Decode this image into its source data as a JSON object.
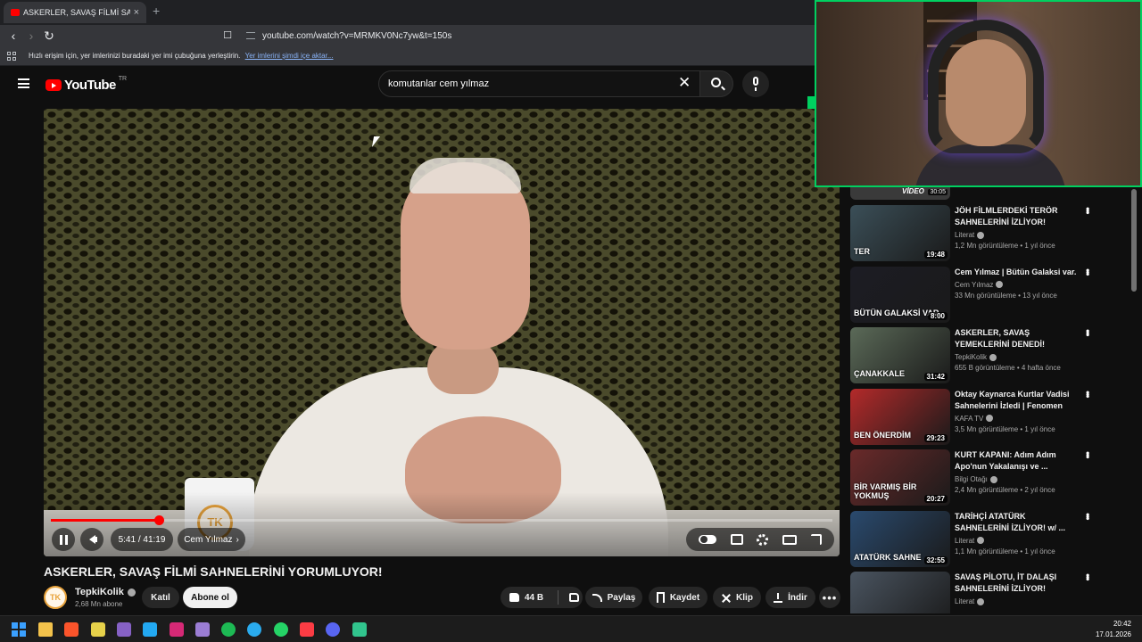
{
  "browser": {
    "tab_title": "ASKERLER, SAVAŞ FİLMİ SAHNE",
    "tab_close": "×",
    "new_tab": "+",
    "url": "youtube.com/watch?v=MRMKV0Nc7yw&t=150s",
    "bookmarks_hint": "Hızlı erişim için, yer imlerinizi buradaki yer imi çubuğuna yerleştirin.",
    "bookmarks_import_link": "Yer imlerini şimdi içe aktar..."
  },
  "youtube": {
    "logo_text": "YouTube",
    "region": "TR",
    "search_query": "komutanlar cem yılmaz"
  },
  "player": {
    "time_display": "5:41 / 41:19",
    "chapter": "Cem Yılmaz",
    "progress_fraction": 0.1376,
    "mug_logo": "TK"
  },
  "video": {
    "title": "ASKERLER, SAVAŞ FİLMİ SAHNELERİNİ YORUMLUYOR!",
    "channel_name": "TepkiKolik",
    "channel_avatar_text": "TK",
    "subscribers": "2,68 Mn abone",
    "join_label": "Katıl",
    "subscribe_label": "Abone ol",
    "likes": "44 B",
    "share_label": "Paylaş",
    "save_label": "Kaydet",
    "clip_label": "Klip",
    "download_label": "İndir"
  },
  "sidebar": {
    "partial": {
      "label": "VİDEO",
      "duration": "30:05"
    },
    "items": [
      {
        "title": "JÖH FİLMLERDEKİ TERÖR SAHNELERİNİ İZLİYOR!",
        "channel": "Literat",
        "views": "1,2 Mn görüntüleme • 1 yıl önce",
        "duration": "19:48",
        "thumb_text": "TER",
        "color": "#3b4f58"
      },
      {
        "title": "Cem Yılmaz | Bütün Galaksi var.",
        "channel": "Cem Yılmaz",
        "views": "33 Mn görüntüleme • 13 yıl önce",
        "duration": "8:00",
        "thumb_text": "BÜTÜN GALAKSİ VAR",
        "color": "#1c1c24"
      },
      {
        "title": "ASKERLER, SAVAŞ YEMEKLERİNİ DENEDİ!",
        "channel": "TepkiKolik",
        "views": "655 B görüntüleme • 4 hafta önce",
        "duration": "31:42",
        "thumb_text": "ÇANAKKALE",
        "color": "#5b6a58"
      },
      {
        "title": "Oktay Kaynarca Kurtlar Vadisi Sahnelerini İzledi | Fenomen",
        "channel": "KAFA TV",
        "views": "3,5 Mn görüntüleme • 1 yıl önce",
        "duration": "29:23",
        "thumb_text": "BEN ÖNERDİM",
        "color": "#b32a2a"
      },
      {
        "title": "KURT KAPANI: Adım Adım Apo'nun Yakalanışı ve ...",
        "channel": "Bilgi Otağı",
        "views": "2,4 Mn görüntüleme • 2 yıl önce",
        "duration": "20:27",
        "thumb_text": "BİR VARMIŞ BİR YOKMUŞ",
        "color": "#6a2a2a"
      },
      {
        "title": "TARİHÇİ ATATÜRK SAHNELERİNİ İZLİYOR! w/ ...",
        "channel": "Literat",
        "views": "1,1 Mn görüntüleme • 1 yıl önce",
        "duration": "32:55",
        "thumb_text": "ATATÜRK SAHNE",
        "color": "#2a4a6e"
      },
      {
        "title": "SAVAŞ PİLOTU, İT DALAŞI SAHNELERİNİ İZLİYOR!",
        "channel": "Literat",
        "views": "",
        "duration": "",
        "thumb_text": "",
        "color": "#4a5460"
      }
    ]
  },
  "taskbar": {
    "time": "20:42",
    "date": "17.01.2026"
  }
}
